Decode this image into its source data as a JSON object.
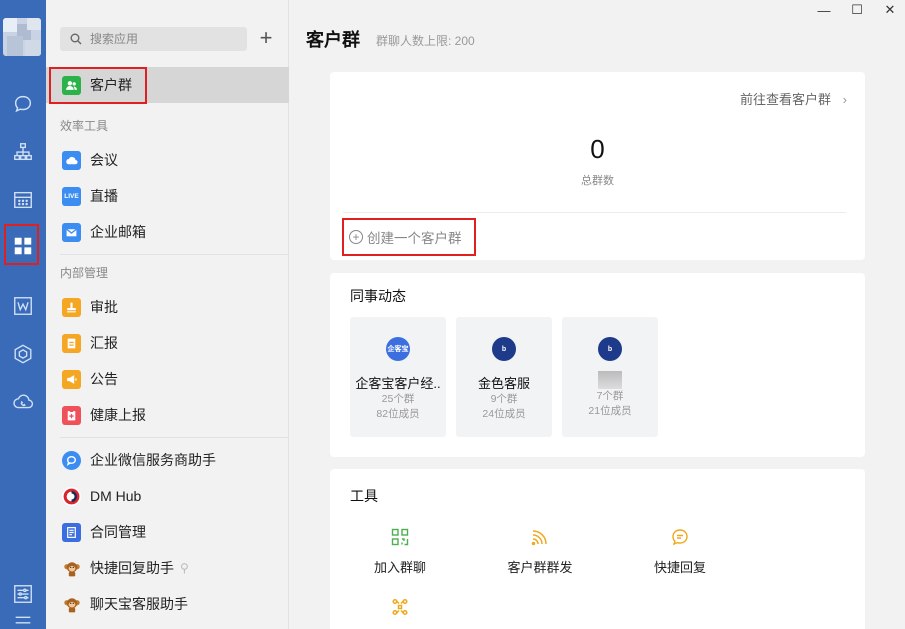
{
  "window": {
    "minimize_label": "—",
    "maximize_label": "☐",
    "close_label": "✕"
  },
  "rail": {
    "items": [
      {
        "icon": "chat-icon"
      },
      {
        "icon": "org-chart-icon"
      },
      {
        "icon": "calendar-icon"
      },
      {
        "icon": "apps-grid-icon",
        "active": true
      },
      {
        "icon": "doc-icon"
      },
      {
        "icon": "cube-icon"
      },
      {
        "icon": "cloud-phone-icon"
      },
      {
        "icon": "settings-sliders-icon"
      }
    ]
  },
  "sidebar": {
    "search_placeholder": "搜索应用",
    "add_label": "+",
    "active_item": {
      "label": "客户群",
      "icon": "customer-group-icon",
      "color": "#2bb34a"
    },
    "sections": [
      {
        "title": "效率工具",
        "items": [
          {
            "label": "会议",
            "icon": "meeting-icon",
            "color": "#3b8df2"
          },
          {
            "label": "直播",
            "icon": "live-icon",
            "color": "#3b8df2",
            "icon_text": "LIVE"
          },
          {
            "label": "企业邮箱",
            "icon": "mail-icon",
            "color": "#3b8df2"
          }
        ]
      },
      {
        "title": "内部管理",
        "items": [
          {
            "label": "审批",
            "icon": "approval-icon",
            "color": "#f5a623"
          },
          {
            "label": "汇报",
            "icon": "report-icon",
            "color": "#f5a623"
          },
          {
            "label": "公告",
            "icon": "announcement-icon",
            "color": "#f5a623"
          },
          {
            "label": "健康上报",
            "icon": "health-report-icon",
            "color": "#f0505a"
          }
        ]
      }
    ],
    "third_party": [
      {
        "label": "企业微信服务商助手",
        "icon": "service-helper-icon",
        "color": "#3b8df2"
      },
      {
        "label": "DM Hub",
        "icon": "dmhub-icon",
        "color": "#d9232d"
      },
      {
        "label": "合同管理",
        "icon": "contract-icon",
        "color": "#3b6fe0"
      },
      {
        "label": "快捷回复助手",
        "icon": "monkey-avatar-icon",
        "color": "#c27a2c"
      },
      {
        "label": "聊天宝客服助手",
        "icon": "monkey-avatar-icon",
        "color": "#c27a2c"
      }
    ]
  },
  "main": {
    "title": "客户群",
    "subtitle": "群聊人数上限: 200",
    "summary": {
      "link_label": "前往查看客户群",
      "total_count": "0",
      "total_label": "总群数",
      "create_label": "创建一个客户群"
    },
    "colleagues": {
      "title": "同事动态",
      "cards": [
        {
          "name": "企客宝客户经..",
          "groups": "25个群",
          "members": "82位成员",
          "logo_text": "企客宝",
          "logo_color": "#3b6fe0"
        },
        {
          "name": "金色客服",
          "groups": "9个群",
          "members": "24位成员",
          "logo_text": "b",
          "logo_color": "#1e3a8a"
        },
        {
          "name": "",
          "groups": "7个群",
          "members": "21位成员",
          "logo_text": "b",
          "logo_color": "#1e3a8a"
        }
      ]
    },
    "tools": {
      "title": "工具",
      "items": [
        {
          "label": "加入群聊",
          "icon": "qr-code-icon"
        },
        {
          "label": "客户群群发",
          "icon": "broadcast-icon"
        },
        {
          "label": "快捷回复",
          "icon": "quick-reply-icon"
        },
        {
          "label": "",
          "icon": "puzzle-icon"
        }
      ]
    }
  },
  "colors": {
    "rail": "#3a6bb8",
    "accent_green": "#4caf50",
    "tool_amber": "#f0a81c",
    "highlight_red": "#e02020"
  }
}
